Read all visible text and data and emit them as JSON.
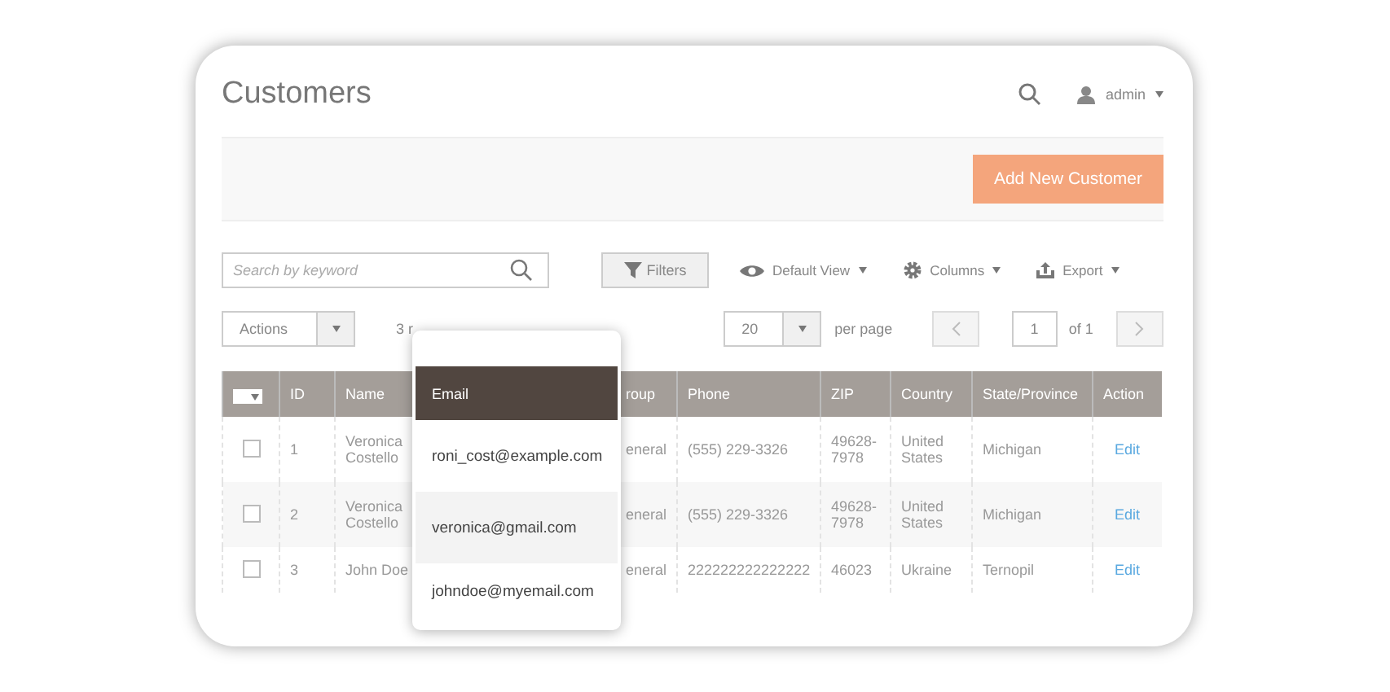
{
  "page": {
    "title": "Customers",
    "user": "admin"
  },
  "actions_bar": {
    "primary_button": "Add New Customer"
  },
  "toolbar": {
    "search": {
      "placeholder": "Search by keyword"
    },
    "filters": "Filters",
    "view": "Default View",
    "columns": "Columns",
    "export": "Export"
  },
  "pager": {
    "mass_action": "Actions",
    "records": "3 r",
    "page_size": "20",
    "per_page": "per page",
    "page": "1",
    "of": "of 1"
  },
  "table": {
    "select_all": {
      "checked": false
    },
    "columns": [
      "ID",
      "Name",
      "roup",
      "Phone",
      "ZIP",
      "Country",
      "State/Province",
      "Action"
    ],
    "rows": [
      {
        "checked": false,
        "cells": [
          "1",
          "Veronica Costello",
          "eneral",
          "(555) 229-3326",
          "49628-7978",
          "United States",
          "Michigan",
          "Edit"
        ]
      },
      {
        "checked": false,
        "cells": [
          "2",
          "Veronica Costello",
          "eneral",
          "(555) 229-3326",
          "49628-7978",
          "United States",
          "Michigan",
          "Edit"
        ]
      },
      {
        "checked": false,
        "cells": [
          "3",
          "John Doe",
          "eneral",
          "222222222222222",
          "46023",
          "Ukraine",
          "Ternopil",
          "Edit"
        ]
      }
    ]
  },
  "popup": {
    "title": "Email",
    "items": [
      {
        "label": "roni_cost@example.com",
        "selected": false
      },
      {
        "label": "veronica@gmail.com",
        "selected": true
      },
      {
        "label": "johndoe@myemail.com",
        "selected": false
      }
    ]
  }
}
